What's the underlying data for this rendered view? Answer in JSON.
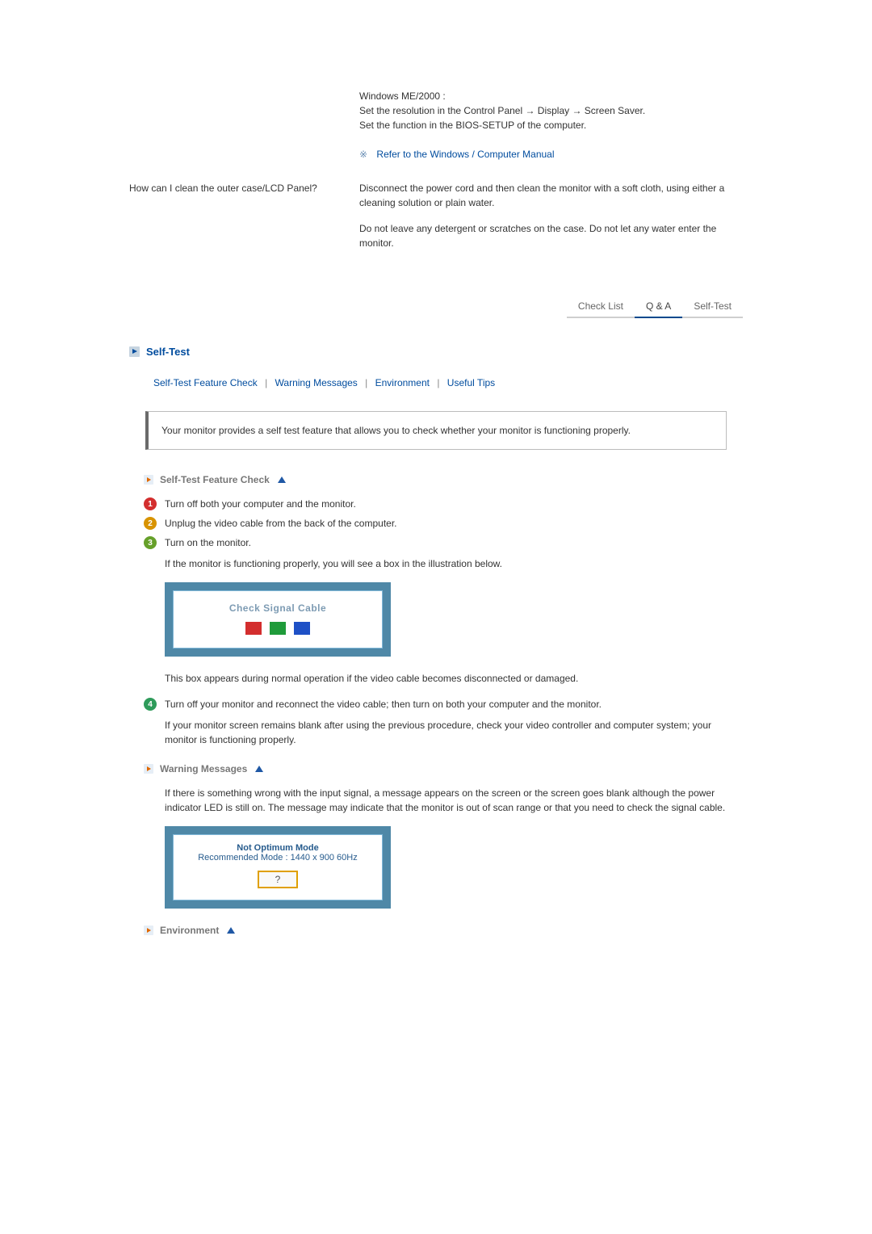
{
  "top_answer_block": {
    "line1": "Windows ME/2000 :",
    "line2": "Set the resolution in the Control Panel → Display → Screen Saver.",
    "line3": "Set the function in the BIOS-SETUP of the computer."
  },
  "manual_ref": "Refer to the Windows / Computer Manual",
  "qa": {
    "question": "How can I clean the outer case/LCD Panel?",
    "answer_p1": "Disconnect the power cord and then clean the monitor with a soft cloth, using either a cleaning solution or plain water.",
    "answer_p2": "Do not leave any detergent or scratches on the case. Do not let any water enter the monitor."
  },
  "tabs": {
    "check_list": "Check List",
    "qa": "Q & A",
    "self_test": "Self-Test"
  },
  "section_title": "Self-Test",
  "sublinks": {
    "a": "Self-Test Feature Check",
    "b": "Warning Messages",
    "c": "Environment",
    "d": "Useful Tips"
  },
  "intro": "Your monitor provides a self test feature that allows you to check whether your monitor is functioning properly.",
  "sub": {
    "self_test_check": "Self-Test Feature Check",
    "warning_messages": "Warning Messages",
    "environment": "Environment"
  },
  "steps": {
    "s1": "Turn off both your computer and the monitor.",
    "s2": "Unplug the video cable from the back of the computer.",
    "s3": "Turn on the monitor.",
    "s3_note": "If the monitor is functioning properly, you will see a box in the illustration below.",
    "signal_label": "Check Signal Cable",
    "s3_after": "This box appears during normal operation if the video cable becomes disconnected or damaged.",
    "s4": "Turn off your monitor and reconnect the video cable; then turn on both your computer and the monitor.",
    "s4_after": "If your monitor screen remains blank after using the previous procedure, check your video controller and computer system; your monitor is functioning properly."
  },
  "warn_p": "If there is something wrong with the input signal, a message appears on the screen or the screen goes blank although the power indicator LED is still on. The message may indicate that the monitor is out of scan range or that you need to check the signal cable.",
  "mode_box": {
    "line1": "Not Optimum Mode",
    "line2": "Recommended Mode : 1440 x 900  60Hz",
    "qmark": "?"
  }
}
